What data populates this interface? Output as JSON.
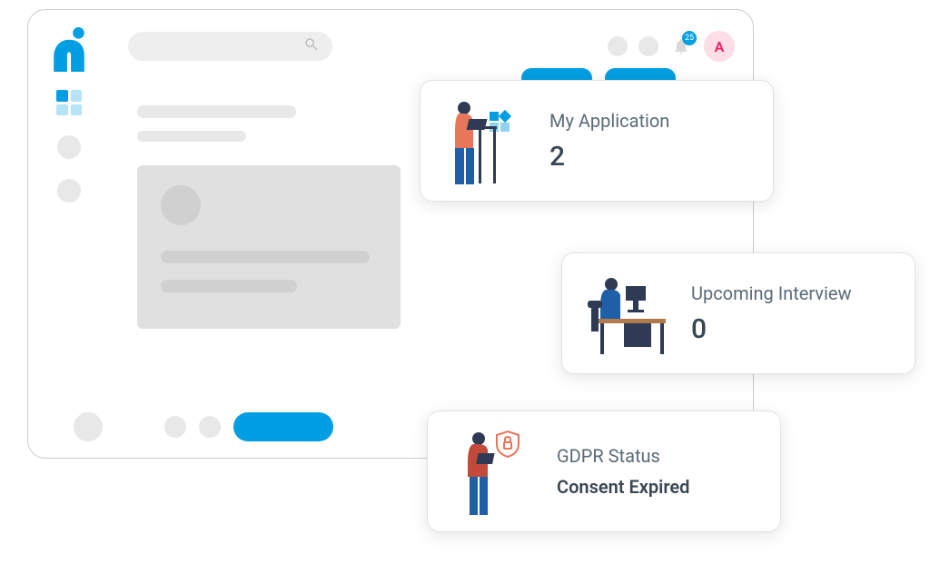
{
  "header": {
    "notification_count": "25",
    "avatar_initial": "A"
  },
  "cards": [
    {
      "title": "My Application",
      "value": "2"
    },
    {
      "title": "Upcoming Interview",
      "value": "0"
    },
    {
      "title": "GDPR Status",
      "value": "Consent Expired"
    }
  ],
  "colors": {
    "accent": "#009ee2",
    "avatar_bg": "#fddde6",
    "avatar_fg": "#e91e63"
  }
}
